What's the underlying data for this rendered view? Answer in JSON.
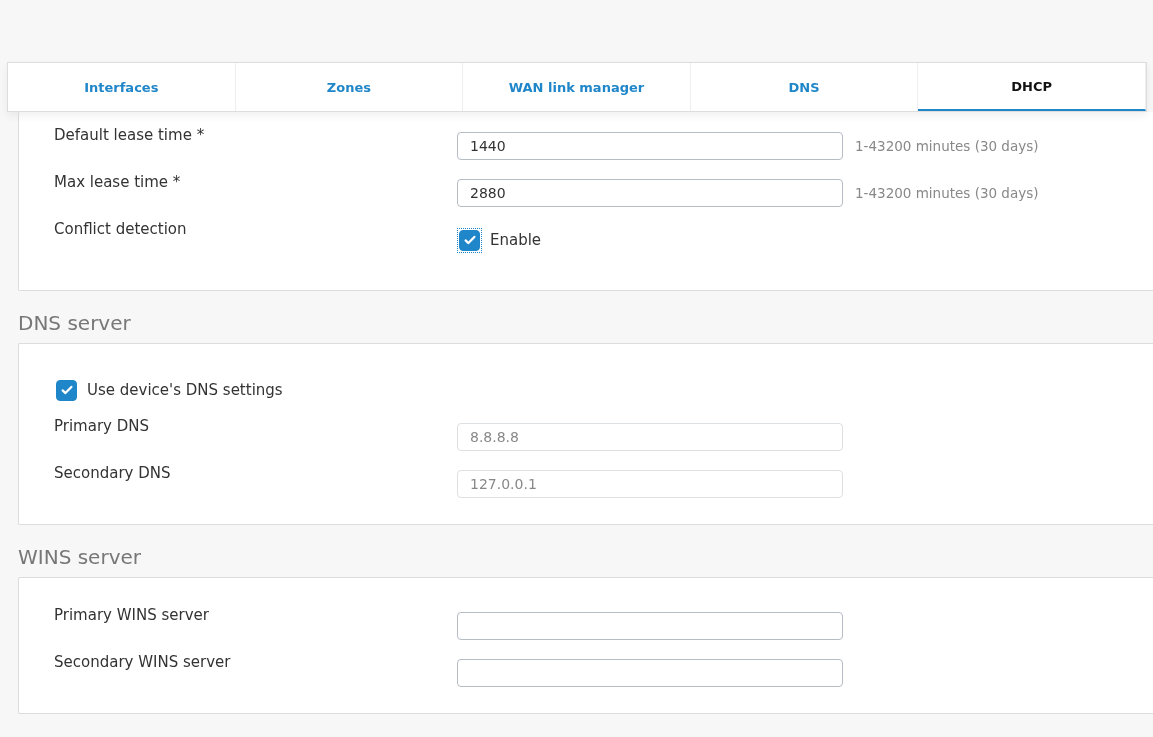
{
  "tabs": [
    {
      "label": "Interfaces",
      "selected": false
    },
    {
      "label": "Zones",
      "selected": false
    },
    {
      "label": "WAN link manager",
      "selected": false
    },
    {
      "label": "DNS",
      "selected": false
    },
    {
      "label": "DHCP",
      "selected": true
    }
  ],
  "sections": [
    {
      "rows": [
        {
          "kind": "text",
          "label": "Default lease time *",
          "value": "1440",
          "hint": "1-43200 minutes (30 days)",
          "disabled": false
        },
        {
          "kind": "text",
          "label": "Max lease time *",
          "value": "2880",
          "hint": "1-43200 minutes (30 days)",
          "disabled": false
        },
        {
          "kind": "checkbox",
          "label": "Conflict detection",
          "option": "Enable",
          "checked": true,
          "focused": true
        }
      ]
    },
    {
      "title": "DNS server",
      "rows": [
        {
          "kind": "check",
          "option": "Use device's DNS settings",
          "checked": true,
          "focused": false
        },
        {
          "kind": "text",
          "label": "Primary DNS",
          "value": "8.8.8.8",
          "disabled": true
        },
        {
          "kind": "text",
          "label": "Secondary DNS",
          "value": "127.0.0.1",
          "disabled": true
        }
      ]
    },
    {
      "title": "WINS server",
      "rows": [
        {
          "kind": "text",
          "label": "Primary WINS server",
          "disabled": false
        },
        {
          "kind": "text",
          "label": "Secondary WINS server",
          "disabled": false
        }
      ]
    }
  ]
}
